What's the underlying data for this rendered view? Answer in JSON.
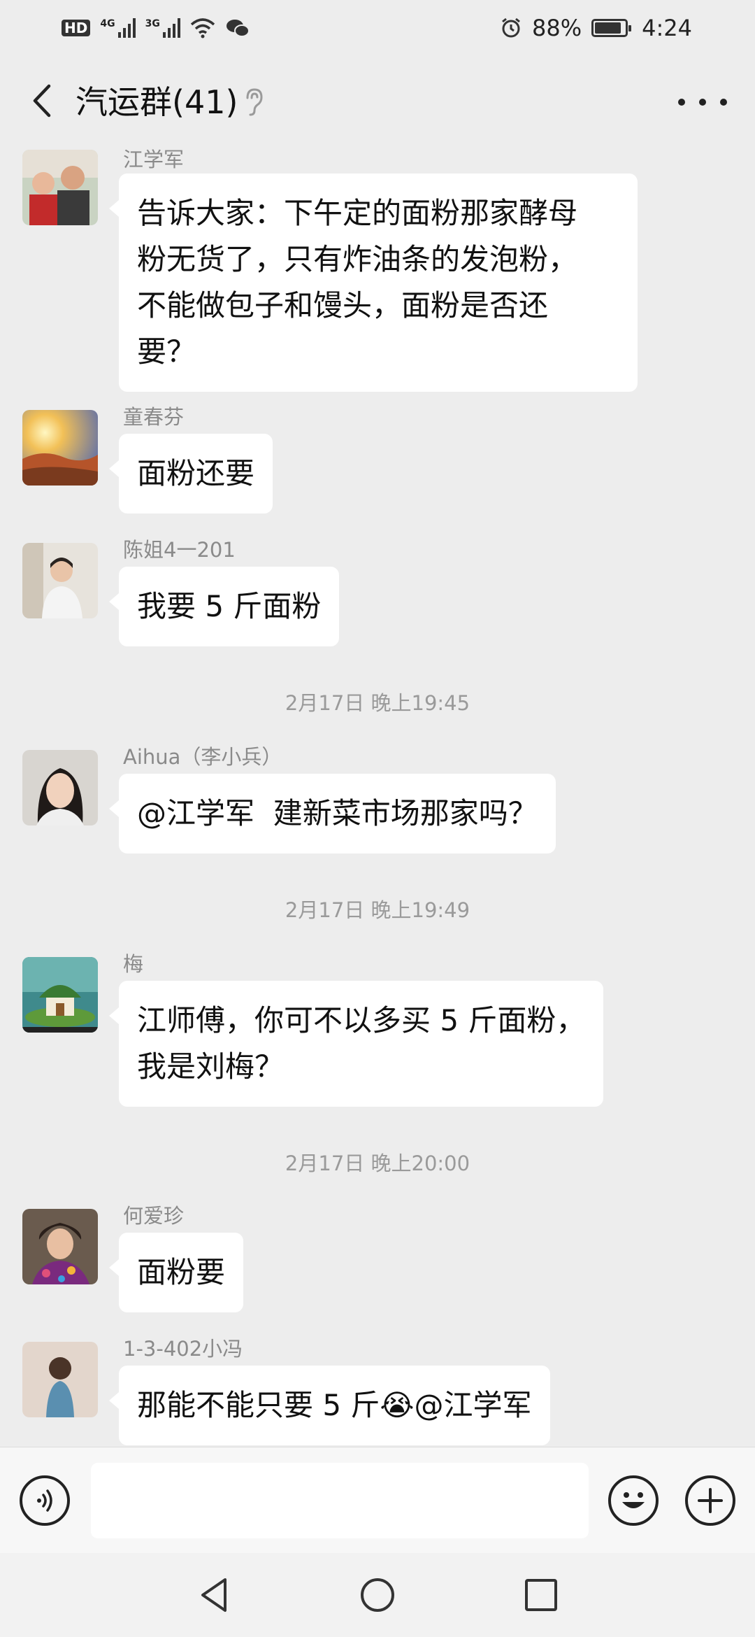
{
  "status_bar": {
    "left_badge": "HD",
    "net1": "4G",
    "net2": "3G",
    "battery_percent": "88%",
    "battery_level": 0.88,
    "time": "4:24",
    "icons": [
      "hd-icon",
      "signal-icon",
      "wifi-icon",
      "wechat-icon",
      "alarm-icon",
      "battery-icon"
    ]
  },
  "header": {
    "title": "汽运群(41)",
    "back_icon": "chevron-left-icon",
    "ear_icon": "ear-icon",
    "more_icon": "more-dots-icon"
  },
  "messages": [
    {
      "type": "msg",
      "sender": "江学军",
      "text": "告诉大家：下午定的面粉那家酵母\n粉无货了，只有炸油条的发泡粉，\n不能做包子和馒头，面粉是否还\n要？",
      "avatar": "family-photo-avatar"
    },
    {
      "type": "msg",
      "sender": "童春芬",
      "text": "面粉还要",
      "avatar": "sunset-landscape-avatar"
    },
    {
      "type": "msg",
      "sender": "陈姐4一201",
      "text": "我要 5 斤面粉",
      "avatar": "woman-at-desk-avatar"
    },
    {
      "type": "time",
      "text": "2月17日 晚上19:45"
    },
    {
      "type": "msg",
      "sender": "Aihua（李小兵）",
      "text": "@江学军  建新菜市场那家吗？",
      "avatar": "woman-portrait-avatar"
    },
    {
      "type": "time",
      "text": "2月17日 晚上19:49"
    },
    {
      "type": "msg",
      "sender": "梅",
      "text": "江师傅，你可不以多买 5 斤面粉，\n我是刘梅？",
      "avatar": "mushroom-house-avatar"
    },
    {
      "type": "time",
      "text": "2月17日 晚上20:00"
    },
    {
      "type": "msg",
      "sender": "何爱珍",
      "text": "面粉要",
      "avatar": "woman-flowers-avatar"
    },
    {
      "type": "msg",
      "sender": "1-3-402小冯",
      "text": "那能不能只要 5 斤😭@江学军",
      "avatar": "girl-back-avatar"
    }
  ],
  "input_bar": {
    "value": "",
    "voice_icon": "voice-icon",
    "emoji_icon": "smiley-icon",
    "plus_icon": "plus-circle-icon"
  },
  "nav": {
    "back_icon": "triangle-back-icon",
    "home_icon": "circle-home-icon",
    "recent_icon": "square-recents-icon"
  },
  "colors": {
    "background": "#ededed",
    "bubble": "#ffffff",
    "meta_text": "#8a8a8a"
  }
}
